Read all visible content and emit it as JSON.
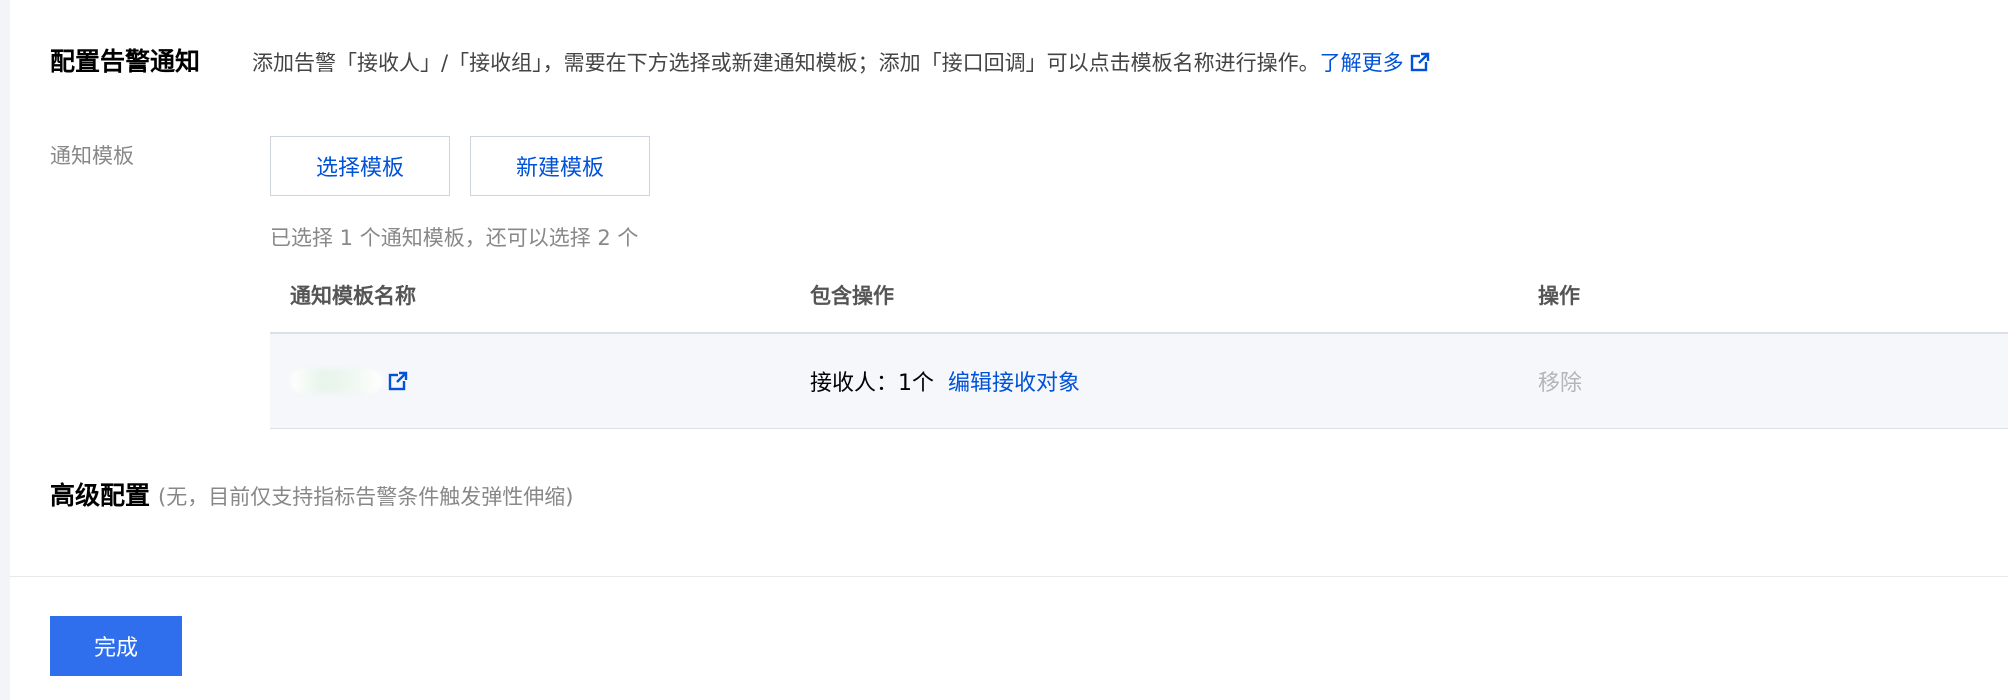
{
  "alert_notification": {
    "title": "配置告警通知",
    "description": "添加告警「接收人」/「接收组」，需要在下方选择或新建通知模板；添加「接口回调」可以点击模板名称进行操作。",
    "learn_more": "了解更多",
    "learn_more_icon": "external-link-icon"
  },
  "template_field": {
    "label": "通知模板",
    "select_button": "选择模板",
    "create_button": "新建模板",
    "selected_hint": "已选择 1 个通知模板，还可以选择 2 个"
  },
  "template_table": {
    "headers": [
      "通知模板名称",
      "包含操作",
      "操作"
    ],
    "rows": [
      {
        "name": "",
        "name_icon": "external-link-icon",
        "receivers": "接收人：1个",
        "edit_action": "编辑接收对象",
        "remove_action": "移除"
      }
    ]
  },
  "advanced_config": {
    "title": "高级配置",
    "note": "(无，目前仅支持指标告警条件触发弹性伸缩)"
  },
  "footer": {
    "done_button": "完成"
  },
  "colors": {
    "link": "#0052d9",
    "primary_button": "#2f6fed",
    "muted_text": "#888888",
    "row_background": "#f5f7fa"
  }
}
